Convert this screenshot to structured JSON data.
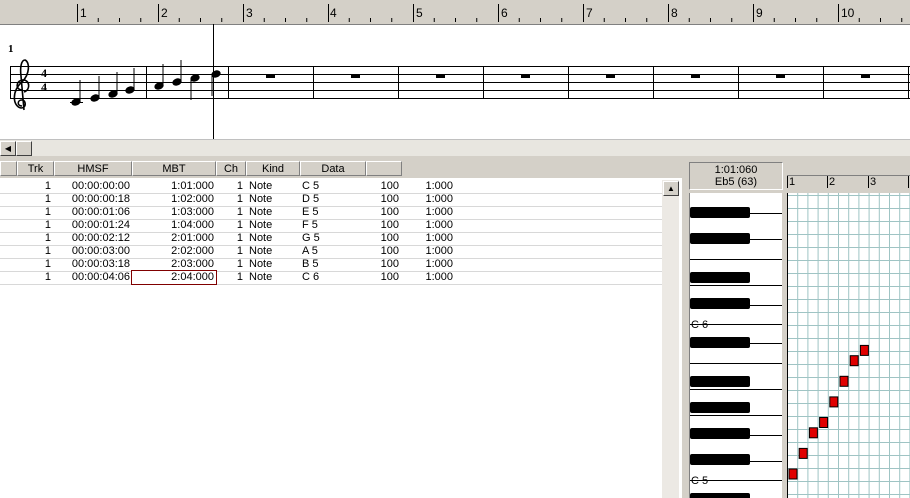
{
  "ruler": {
    "measures": [
      "1",
      "2",
      "3",
      "4",
      "5",
      "6",
      "7",
      "8",
      "9",
      "10"
    ]
  },
  "staff": {
    "measure_number": "1",
    "time_signature_top": "4",
    "time_signature_bottom": "4"
  },
  "event_list": {
    "columns": [
      "Trk",
      "HMSF",
      "MBT",
      "Ch",
      "Kind",
      "Data"
    ],
    "rows": [
      {
        "trk": "1",
        "hmsf": "00:00:00:00",
        "mbt": "1:01:000",
        "ch": "1",
        "kind": "Note",
        "note": "C 5",
        "vel": "100",
        "dur": "1:000"
      },
      {
        "trk": "1",
        "hmsf": "00:00:00:18",
        "mbt": "1:02:000",
        "ch": "1",
        "kind": "Note",
        "note": "D 5",
        "vel": "100",
        "dur": "1:000"
      },
      {
        "trk": "1",
        "hmsf": "00:00:01:06",
        "mbt": "1:03:000",
        "ch": "1",
        "kind": "Note",
        "note": "E 5",
        "vel": "100",
        "dur": "1:000"
      },
      {
        "trk": "1",
        "hmsf": "00:00:01:24",
        "mbt": "1:04:000",
        "ch": "1",
        "kind": "Note",
        "note": "F 5",
        "vel": "100",
        "dur": "1:000"
      },
      {
        "trk": "1",
        "hmsf": "00:00:02:12",
        "mbt": "2:01:000",
        "ch": "1",
        "kind": "Note",
        "note": "G 5",
        "vel": "100",
        "dur": "1:000"
      },
      {
        "trk": "1",
        "hmsf": "00:00:03:00",
        "mbt": "2:02:000",
        "ch": "1",
        "kind": "Note",
        "note": "A 5",
        "vel": "100",
        "dur": "1:000"
      },
      {
        "trk": "1",
        "hmsf": "00:00:03:18",
        "mbt": "2:03:000",
        "ch": "1",
        "kind": "Note",
        "note": "B 5",
        "vel": "100",
        "dur": "1:000"
      },
      {
        "trk": "1",
        "hmsf": "00:00:04:06",
        "mbt": "2:04:000",
        "ch": "1",
        "kind": "Note",
        "note": "C 6",
        "vel": "100",
        "dur": "1:000"
      }
    ]
  },
  "piano": {
    "position": "1:01:060",
    "pitch": "Eb5 (63)",
    "labels": {
      "c6": "C 6",
      "c5": "C 5"
    },
    "ruler": [
      "1",
      "2",
      "3"
    ]
  },
  "colors": {
    "note_fill": "#e00000",
    "grid_line": "#9fc4c4",
    "cursor": "#000000"
  }
}
